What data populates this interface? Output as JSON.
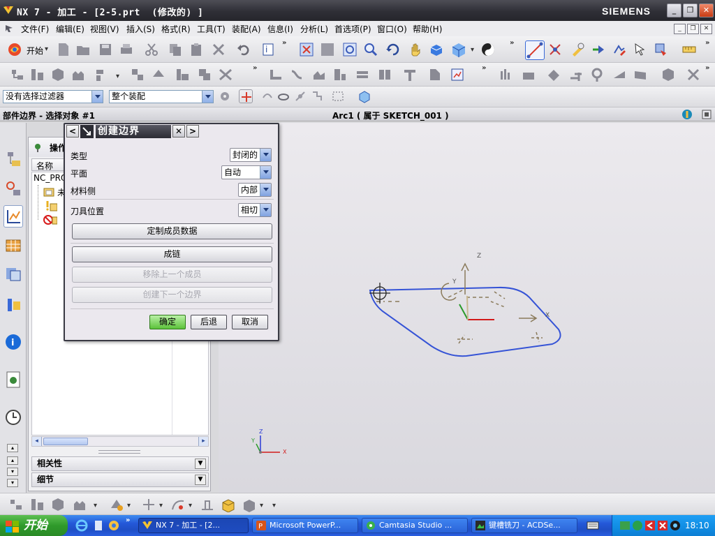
{
  "titlebar": {
    "title": "NX 7 - 加工 - [2-5.prt  (修改的) ]",
    "brand": "SIEMENS",
    "min": "_",
    "restore": "❐",
    "close": "✕"
  },
  "menubar": {
    "items": [
      "文件(F)",
      "编辑(E)",
      "视图(V)",
      "插入(S)",
      "格式(R)",
      "工具(T)",
      "装配(A)",
      "信息(I)",
      "分析(L)",
      "首选项(P)",
      "窗口(O)",
      "帮助(H)"
    ],
    "doc_min": "_",
    "doc_restore": "❐",
    "doc_close": "✕"
  },
  "toolbar": {
    "start_label": "开始",
    "start_arrow": "▾",
    "more": "»"
  },
  "selection_bar": {
    "filter_value": "没有选择过滤器",
    "scope_value": "整个装配"
  },
  "cue": {
    "prompt": "部件边界 - 选择对象 #1",
    "status": "Arc1 ( 属于 SKETCH_001 )"
  },
  "navigator": {
    "title": "操作",
    "column_name": "名称",
    "root": "NC_PRO",
    "node1": "未",
    "panels": [
      "相关性",
      "细节"
    ],
    "scroll_left": "◂",
    "scroll_right": "▸",
    "scroll_up": "▴",
    "scroll_down": "▾"
  },
  "dialog": {
    "title": "创建边界",
    "prev": "<",
    "next": ">",
    "close": "✕",
    "rows": [
      {
        "label": "类型",
        "value": "封闭的"
      },
      {
        "label": "平面",
        "value": "自动"
      },
      {
        "label": "材料侧",
        "value": "内部"
      },
      {
        "label": "刀具位置",
        "value": "相切"
      }
    ],
    "buttons": {
      "custom_member": "定制成员数据",
      "chain": "成链",
      "remove_last": "移除上一个成员",
      "create_next": "创建下一个边界"
    },
    "ok": "确定",
    "back": "后退",
    "cancel": "取消"
  },
  "viewport": {
    "axis_x": "X",
    "axis_y": "Y",
    "axis_z": "Z"
  },
  "taskbar": {
    "start": "开始",
    "tasks": [
      "NX 7 - 加工 - [2...",
      "Microsoft PowerP...",
      "Camtasia Studio ...",
      "键槽铣刀 - ACDSe..."
    ],
    "clock": "18:10"
  },
  "colors": {
    "sketch_curve": "#3553d6",
    "wcs_x": "#d21a1a",
    "wcs_y": "#2a9a2a",
    "wcs_z": "#2a3ad6",
    "datum": "#8a7a5a"
  }
}
